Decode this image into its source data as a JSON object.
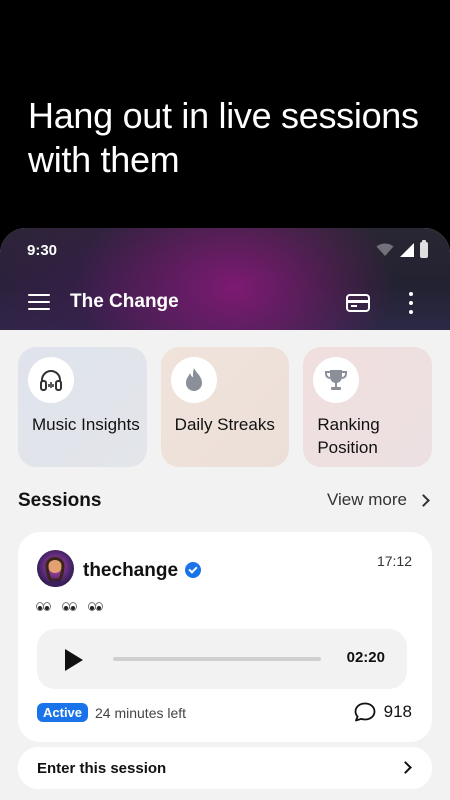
{
  "promo": {
    "headline": "Hang out in live sessions with them"
  },
  "status_bar": {
    "time": "9:30",
    "icons": [
      "wifi-icon",
      "signal-icon",
      "battery-icon"
    ]
  },
  "app_bar": {
    "title": "The Change",
    "icons": [
      "menu-icon",
      "card-icon",
      "more-vertical-icon"
    ]
  },
  "tiles": [
    {
      "label": "Music Insights",
      "icon": "headphones-icon",
      "bg": "#e1e4eb"
    },
    {
      "label": "Daily Streaks",
      "icon": "flame-icon",
      "bg": "#eee1da"
    },
    {
      "label": "Ranking Position",
      "icon": "trophy-icon",
      "bg": "#efdfe0"
    }
  ],
  "sessions": {
    "title": "Sessions",
    "view_more": "View more"
  },
  "session_card": {
    "username": "thechange",
    "verified": true,
    "time": "17:12",
    "message": "👀👀👀",
    "audio": {
      "duration": "02:20",
      "progress": 0
    },
    "status_badge": "Active",
    "time_left": "24 minutes left",
    "comment_count": "918",
    "accent_color": "#1a73e8"
  },
  "enter": {
    "label": "Enter this session"
  }
}
